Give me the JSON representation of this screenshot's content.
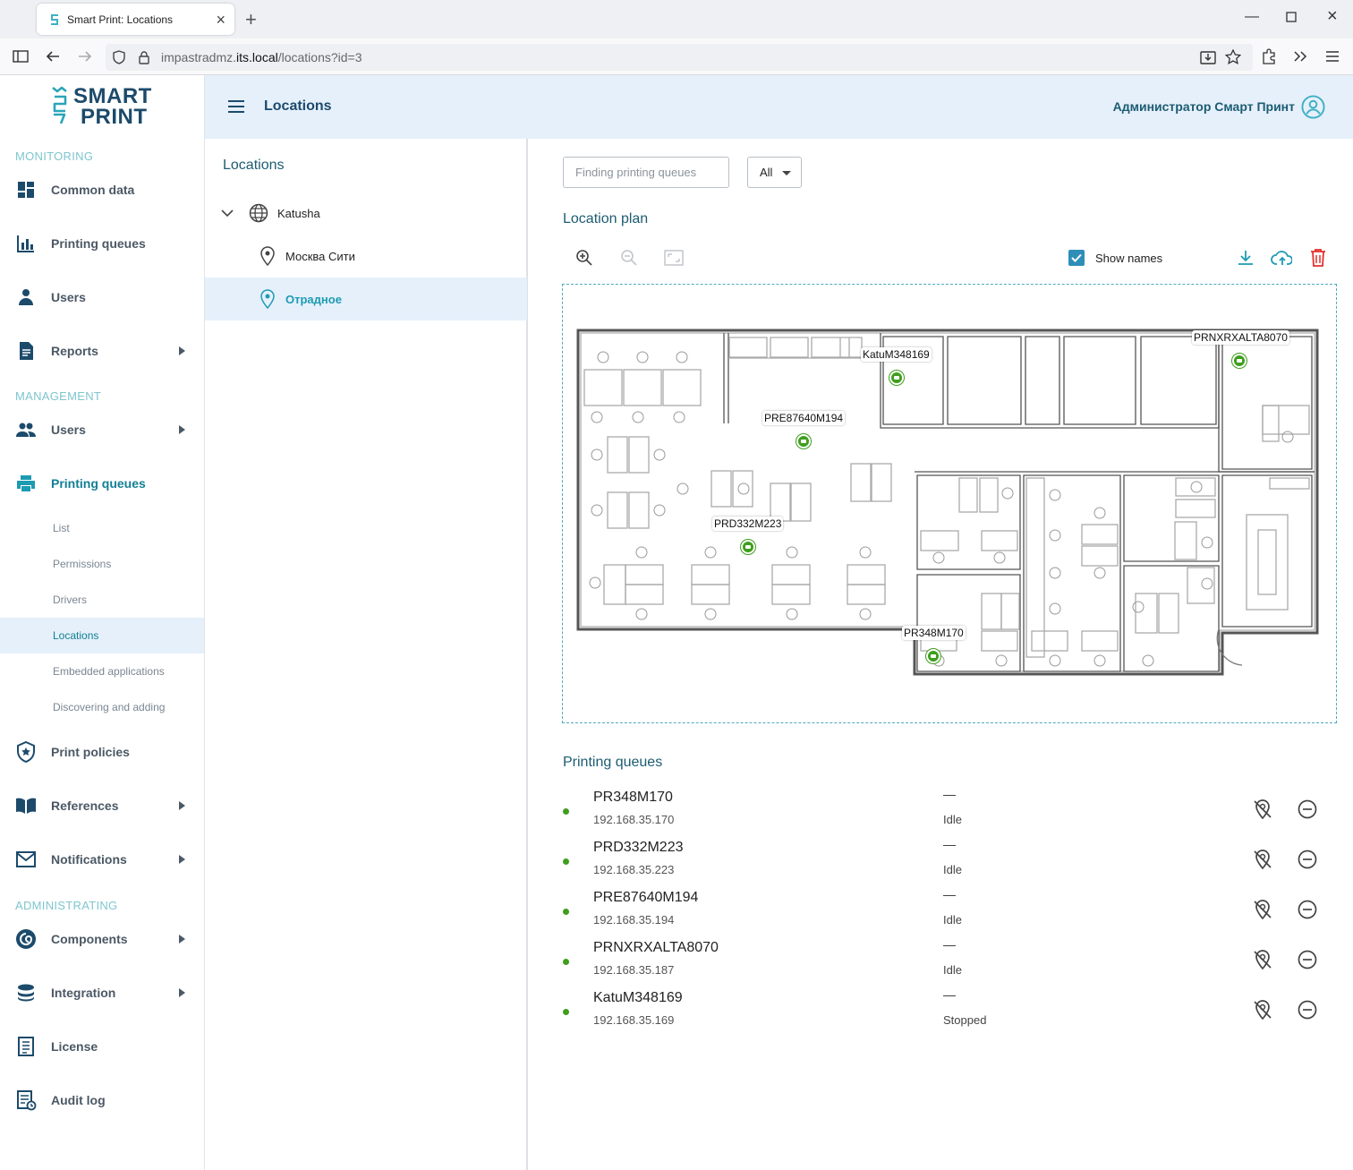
{
  "browser": {
    "tab_title": "Smart Print: Locations",
    "url_host_prefix": "impastradmz.",
    "url_host_bold": "its.local",
    "url_path": "/locations?id=3"
  },
  "logo": {
    "line1": "SMART",
    "line2": "PRINT"
  },
  "sidebar": {
    "monitoring": "MONITORING",
    "management": "MANAGEMENT",
    "administrating": "ADMINISTRATING",
    "items": {
      "common_data": "Common data",
      "printing_queues_mon": "Printing queues",
      "users_mon": "Users",
      "reports": "Reports",
      "users_mgmt": "Users",
      "printing_queues": "Printing queues",
      "print_policies": "Print policies",
      "references": "References",
      "notifications": "Notifications",
      "components": "Components",
      "integration": "Integration",
      "license": "License",
      "audit_log": "Audit log"
    },
    "sub_items": [
      "List",
      "Permissions",
      "Drivers",
      "Locations",
      "Embedded applications",
      "Discovering and adding"
    ]
  },
  "header": {
    "title": "Locations",
    "user": "Администратор Смарт Принт"
  },
  "tree": {
    "title": "Locations",
    "root": "Katusha",
    "children": [
      "Москва Сити",
      "Отрадное"
    ]
  },
  "filter": {
    "search_placeholder": "Finding printing queues",
    "select_value": "All"
  },
  "plan": {
    "title": "Location plan",
    "show_names_label": "Show names",
    "show_names_checked": true,
    "accent_color": "#3f9e1d",
    "markers": [
      "KatuM348169",
      "PRNXRXALTA8070",
      "PRE87640M194",
      "PRD332M223",
      "PR348M170"
    ]
  },
  "queues": {
    "title": "Printing queues",
    "items": [
      {
        "name": "PR348M170",
        "ip": "192.168.35.170",
        "dash": "—",
        "state": "Idle"
      },
      {
        "name": "PRD332M223",
        "ip": "192.168.35.223",
        "dash": "—",
        "state": "Idle"
      },
      {
        "name": "PRE87640M194",
        "ip": "192.168.35.194",
        "dash": "—",
        "state": "Idle"
      },
      {
        "name": "PRNXRXALTA8070",
        "ip": "192.168.35.187",
        "dash": "—",
        "state": "Idle"
      },
      {
        "name": "KatuM348169",
        "ip": "192.168.35.169",
        "dash": "—",
        "state": "Stopped"
      }
    ]
  }
}
